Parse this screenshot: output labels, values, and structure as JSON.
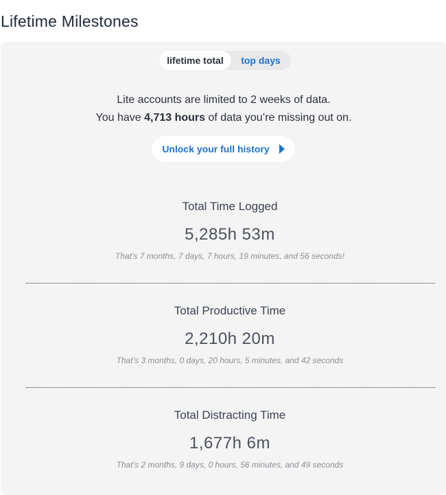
{
  "page": {
    "title": "Lifetime Milestones"
  },
  "toggle": {
    "options": [
      {
        "label": "lifetime total",
        "active": true
      },
      {
        "label": "top days",
        "active": false
      }
    ]
  },
  "lite_notice": {
    "line1": "Lite accounts are limited to 2 weeks of data.",
    "line2_prefix": "You have ",
    "line2_bold": "4,713 hours",
    "line2_suffix": " of data you’re missing out on."
  },
  "unlock_button": {
    "label": "Unlock your full history",
    "icon": "play-triangle-icon"
  },
  "stats": [
    {
      "label": "Total Time Logged",
      "value": "5,285h 53m",
      "detail": "That’s 7 months, 7 days, 7 hours, 19 minutes, and 56 seconds!"
    },
    {
      "label": "Total Productive Time",
      "value": "2,210h 20m",
      "detail": "That’s 3 months, 0 days, 20 hours, 5 minutes, and 42 seconds"
    },
    {
      "label": "Total Distracting Time",
      "value": "1,677h 6m",
      "detail": "That’s 2 months, 9 days, 0 hours, 56 minutes, and 49 seconds"
    }
  ],
  "colors": {
    "accent": "#1e73c9",
    "panel_bg": "#f4f4f4"
  }
}
